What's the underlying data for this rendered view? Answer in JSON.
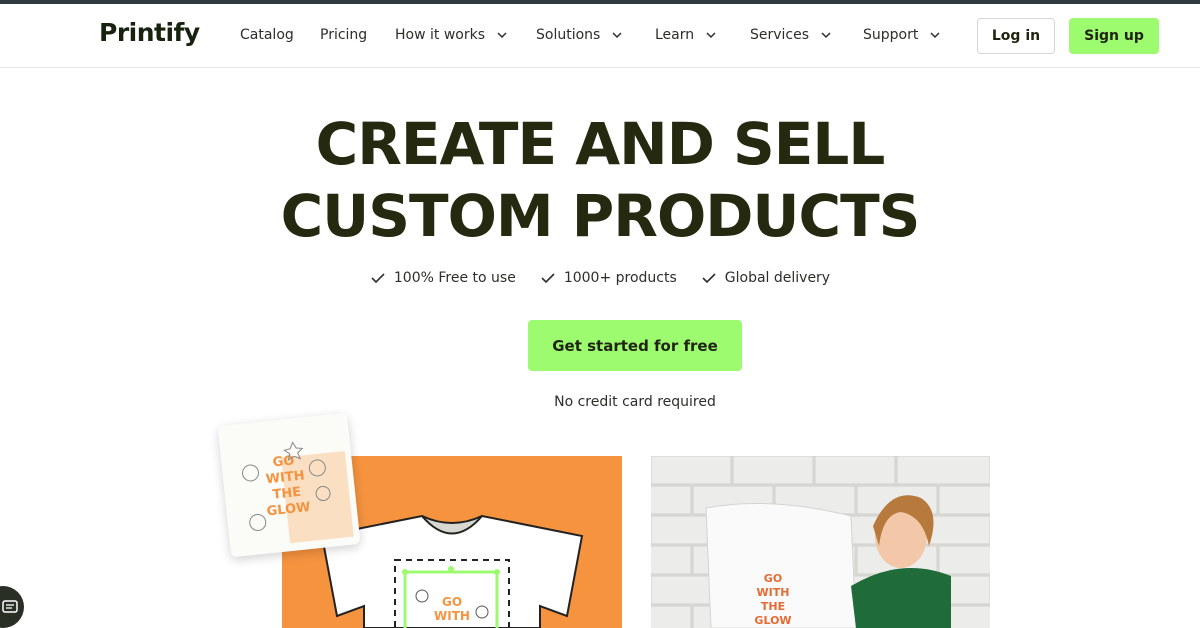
{
  "brand": {
    "logo_text": "Printify",
    "accent": "#9dfb70",
    "title_color": "#25290f",
    "orange": "#f5933f"
  },
  "nav": {
    "items": [
      {
        "label": "Catalog",
        "has_dropdown": false
      },
      {
        "label": "Pricing",
        "has_dropdown": false
      },
      {
        "label": "How it works",
        "has_dropdown": true
      },
      {
        "label": "Solutions",
        "has_dropdown": true
      },
      {
        "label": "Learn",
        "has_dropdown": true
      },
      {
        "label": "Services",
        "has_dropdown": true
      },
      {
        "label": "Support",
        "has_dropdown": true
      }
    ],
    "login_label": "Log in",
    "signup_label": "Sign up"
  },
  "hero": {
    "title_line1": "CREATE AND SELL",
    "title_line2": "CUSTOM PRODUCTS",
    "features": [
      "100% Free to use",
      "1000+ products",
      "Global delivery"
    ],
    "cta_label": "Get started for free",
    "subtext": "No credit card required"
  },
  "artwork": {
    "text_lines": [
      "GO",
      "WITH",
      "THE",
      "GLOW"
    ]
  }
}
